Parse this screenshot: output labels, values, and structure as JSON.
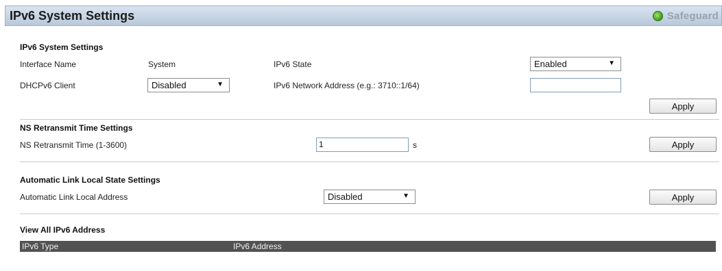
{
  "header": {
    "title": "IPv6 System Settings",
    "safeguard_label": "Safeguard"
  },
  "ipv6_system": {
    "section_title": "IPv6 System Settings",
    "interface_name_label": "Interface Name",
    "interface_name_value": "System",
    "ipv6_state_label": "IPv6 State",
    "ipv6_state_value": "Enabled",
    "dhcpv6_label": "DHCPv6 Client",
    "dhcpv6_value": "Disabled",
    "network_address_label": "IPv6 Network Address (e.g.: 3710::1/64)",
    "network_address_value": "",
    "apply_label": "Apply"
  },
  "ns_retransmit": {
    "section_title": "NS Retransmit Time Settings",
    "time_label": "NS Retransmit Time (1-3600)",
    "time_value": "1",
    "unit": "s",
    "apply_label": "Apply"
  },
  "link_local": {
    "section_title": "Automatic Link Local State Settings",
    "address_label": "Automatic Link Local Address",
    "address_value": "Disabled",
    "apply_label": "Apply"
  },
  "view_all": {
    "section_title": "View All IPv6 Address",
    "columns": [
      "IPv6 Type",
      "IPv6 Address"
    ]
  },
  "icons": {
    "dropdown": "chevron-down-icon",
    "safeguard": "safeguard-status-icon"
  }
}
